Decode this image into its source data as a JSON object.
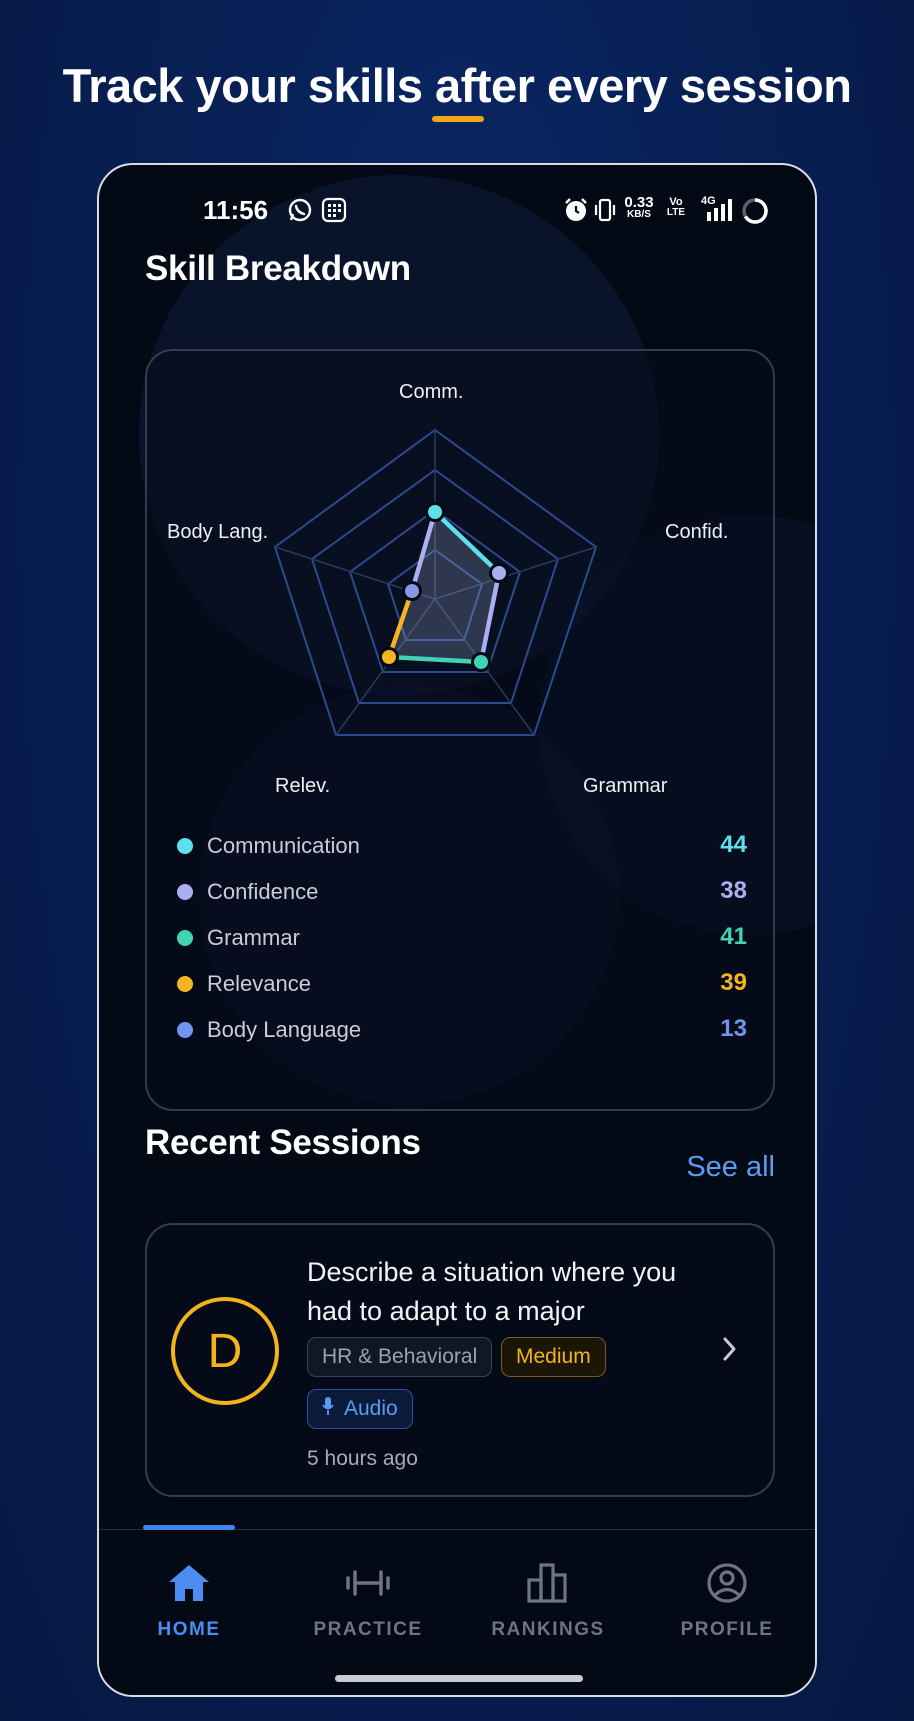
{
  "headline": "Track your skills after every session",
  "status_bar": {
    "time": "11:56",
    "net_speed_value": "0.33",
    "net_speed_unit": "KB/S",
    "volte_top": "Vo",
    "volte_bottom": "LTE",
    "network": "4G"
  },
  "skills": {
    "title": "Skill Breakdown",
    "axis_labels": {
      "comm": "Comm.",
      "confid": "Confid.",
      "grammar": "Grammar",
      "relev": "Relev.",
      "body": "Body Lang."
    },
    "items": [
      {
        "name": "Communication",
        "value": "44",
        "color": "#5ee0ec"
      },
      {
        "name": "Confidence",
        "value": "38",
        "color": "#a9aff0"
      },
      {
        "name": "Grammar",
        "value": "41",
        "color": "#3fd5b4"
      },
      {
        "name": "Relevance",
        "value": "39",
        "color": "#f5b521"
      },
      {
        "name": "Body Language",
        "value": "13",
        "color": "#6f95f2"
      }
    ]
  },
  "recent": {
    "title": "Recent Sessions",
    "see_all": "See all",
    "sessions": [
      {
        "avatar_letter": "D",
        "question": "Describe a situation where you had to adapt to a major change.",
        "category": "HR & Behavioral",
        "difficulty": "Medium",
        "mode": "Audio",
        "time_ago": "5 hours ago"
      }
    ]
  },
  "nav": {
    "items": [
      {
        "label": "HOME",
        "icon": "home-icon",
        "active": true
      },
      {
        "label": "PRACTICE",
        "icon": "dumbbell-icon",
        "active": false
      },
      {
        "label": "RANKINGS",
        "icon": "bar-chart-icon",
        "active": false
      },
      {
        "label": "PROFILE",
        "icon": "user-circle-icon",
        "active": false
      }
    ]
  },
  "colors": {
    "accent": "#3f83ec",
    "gold": "#f2b31e",
    "background": "#030915"
  }
}
